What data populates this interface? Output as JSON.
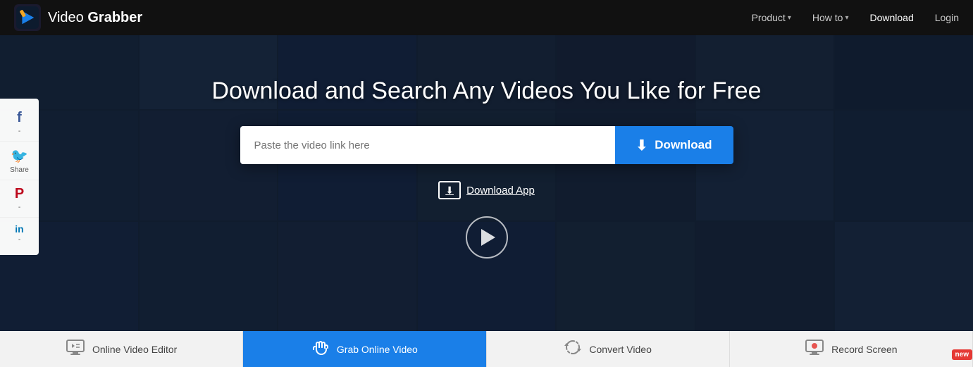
{
  "navbar": {
    "logo_text_plain": "Video ",
    "logo_text_bold": "Grabber",
    "nav_items": [
      {
        "label": "Product",
        "has_chevron": true
      },
      {
        "label": "How to",
        "has_chevron": true
      },
      {
        "label": "Download",
        "has_chevron": false
      },
      {
        "label": "Login",
        "has_chevron": false
      }
    ]
  },
  "hero": {
    "title": "Download and Search Any Videos You Like for Free",
    "search_placeholder": "Paste the video link here",
    "download_button_label": "Download"
  },
  "social": {
    "items": [
      {
        "icon": "f",
        "label": "-",
        "css_class": "fb-icon"
      },
      {
        "icon": "𝕋",
        "label": "Share",
        "css_class": "tw-icon"
      },
      {
        "icon": "𝐏",
        "label": "-",
        "css_class": "pt-icon"
      },
      {
        "icon": "in",
        "label": "-",
        "css_class": "li-icon"
      }
    ]
  },
  "download_app": {
    "label": "Download App"
  },
  "bottom_tabs": [
    {
      "label": "Online Video Editor",
      "active": false
    },
    {
      "label": "Grab Online Video",
      "active": true
    },
    {
      "label": "Convert Video",
      "active": false
    },
    {
      "label": "Record Screen",
      "active": false,
      "has_new": true
    }
  ]
}
